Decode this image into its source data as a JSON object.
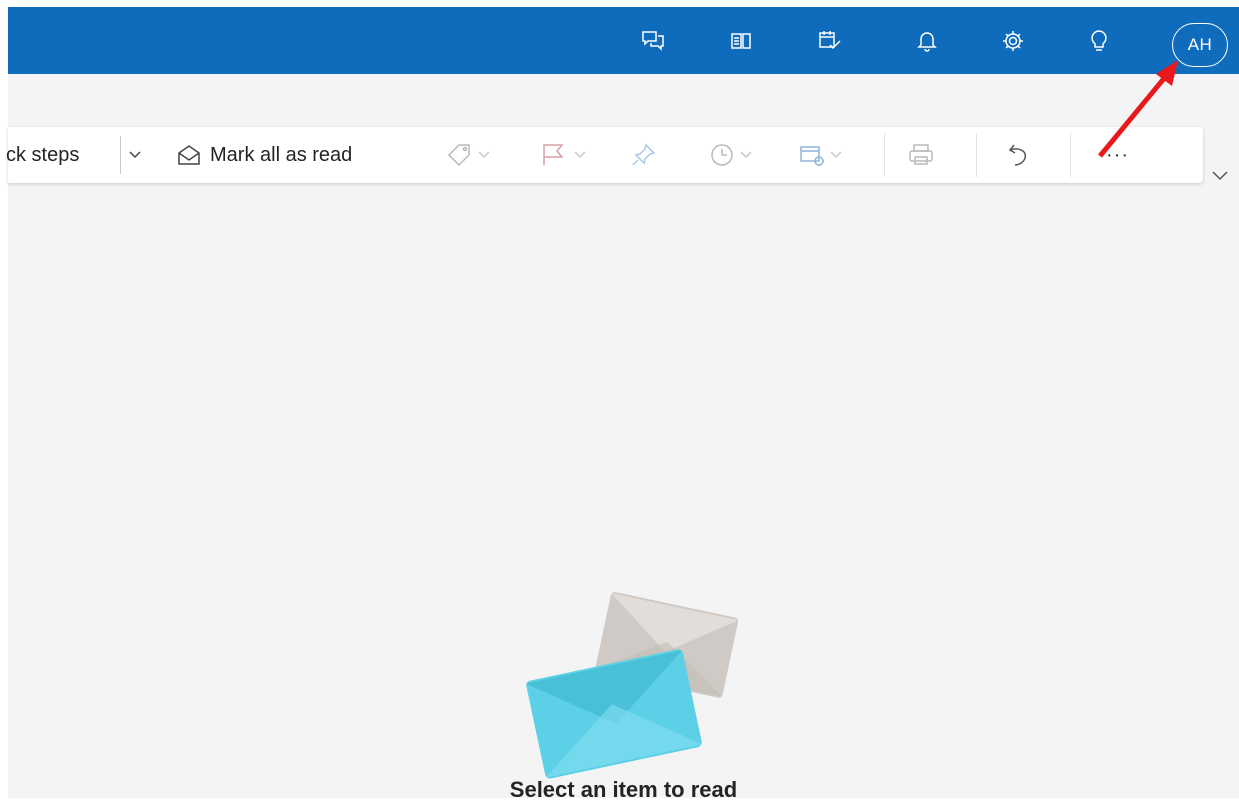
{
  "header": {
    "avatar_initials": "AH",
    "icons": [
      "chat-feedback-icon",
      "office-apps-icon",
      "my-day-icon",
      "bell-icon",
      "gear-icon",
      "lightbulb-icon"
    ],
    "brand_color": "#0f6cbd"
  },
  "ribbon": {
    "quick_steps_label": "ck steps",
    "mark_all_read_label": "Mark all as read",
    "more_label": "···"
  },
  "reading_pane": {
    "empty_message": "Select an item to read"
  },
  "annotation": {
    "arrow_color": "#e8181b"
  }
}
